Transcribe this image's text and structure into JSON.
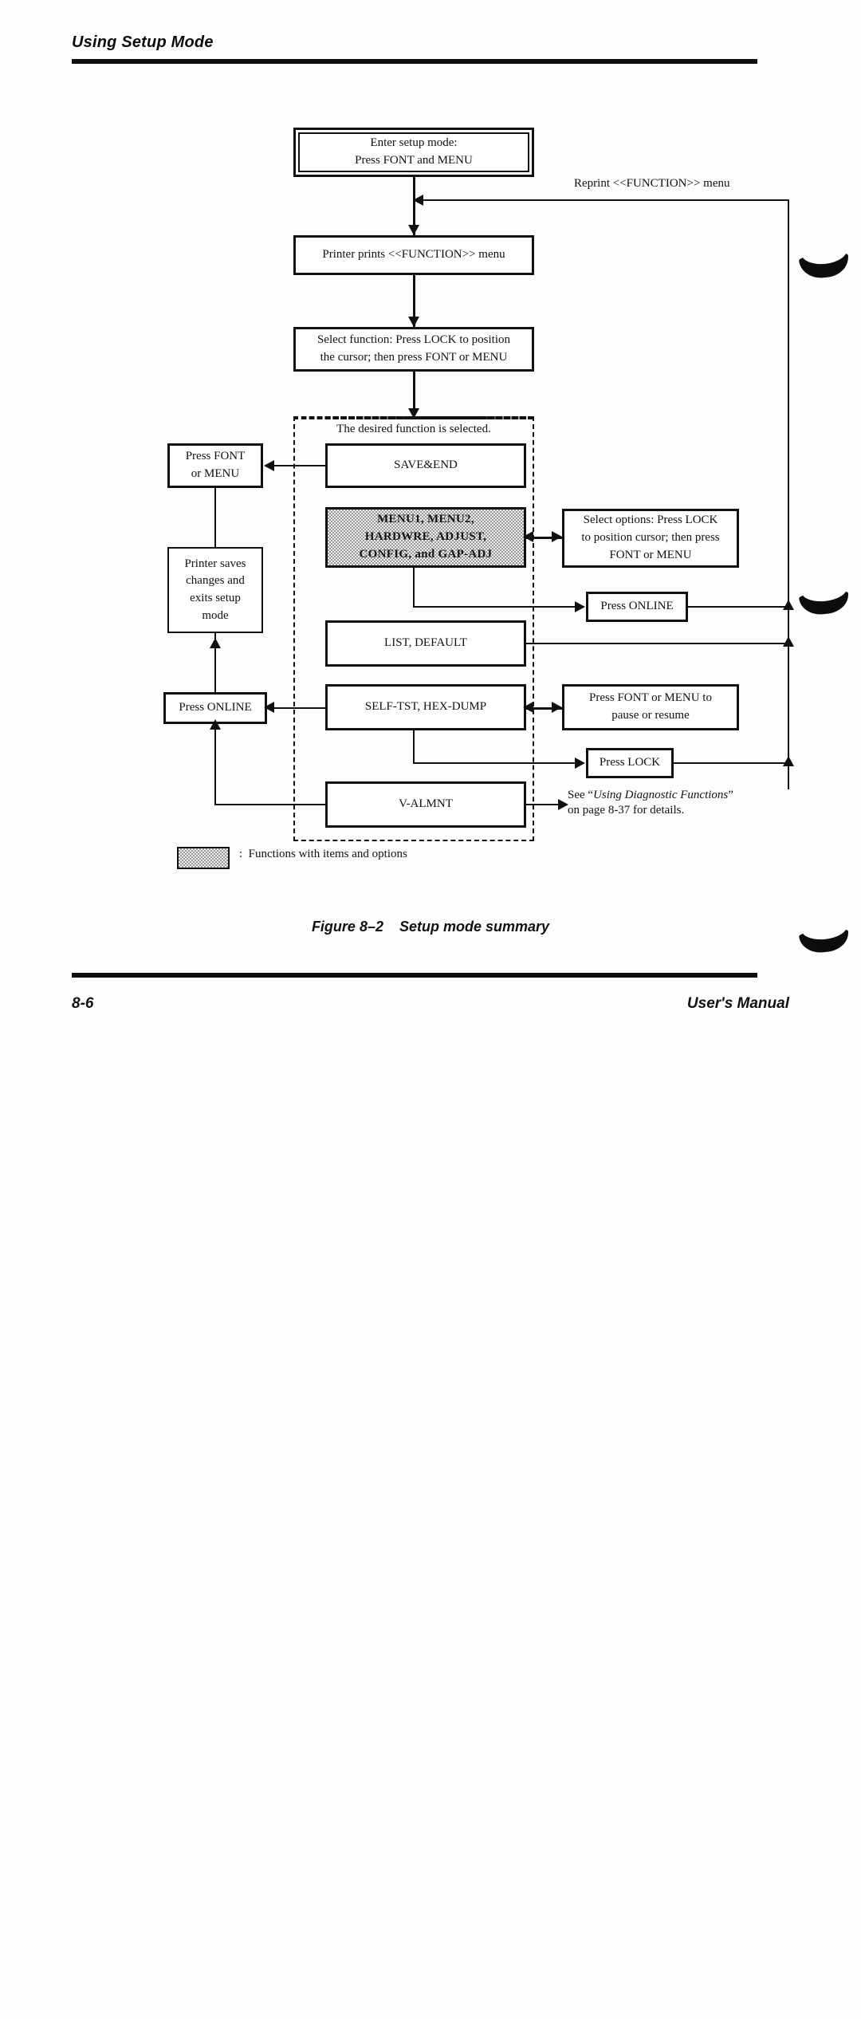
{
  "header": {
    "running_head": "Using Setup Mode"
  },
  "footer": {
    "page_number": "8-6",
    "manual_name": "User's Manual"
  },
  "figure": {
    "caption_number": "Figure 8–2",
    "caption_title": "Setup mode summary",
    "legend_separator": ":",
    "legend_text": "Functions with items and options",
    "group_caption": "The desired function is selected."
  },
  "nodes": {
    "enter_setup": "Enter setup mode:\nPress FONT and MENU",
    "enter_setup_l1": "Enter setup mode:",
    "enter_setup_l2": "Press FONT and MENU",
    "printer_prints": "Printer prints <<FUNCTION>> menu",
    "select_function_l1": "Select function: Press LOCK to position",
    "select_function_l2": "the cursor; then press FONT or MENU",
    "press_font_or_menu_l1": "Press FONT",
    "press_font_or_menu_l2": "or MENU",
    "printer_saves_l1": "Printer saves",
    "printer_saves_l2": "changes and",
    "printer_saves_l3": "exits setup",
    "printer_saves_l4": "mode",
    "press_online_left": "Press ONLINE",
    "save_end": "SAVE&END",
    "menu_group_l1": "MENU1, MENU2,",
    "menu_group_l2": "HARDWRE, ADJUST,",
    "menu_group_l3": "CONFIG, and GAP-ADJ",
    "list_default": "LIST, DEFAULT",
    "self_test": "SELF-TST, HEX-DUMP",
    "v_almnt": "V-ALMNT",
    "select_options_l1": "Select options: Press LOCK",
    "select_options_l2": "to position cursor; then press",
    "select_options_l3": "FONT or MENU",
    "press_online_right": "Press ONLINE",
    "pause_resume_l1": "Press FONT or MENU to",
    "pause_resume_l2": "pause or resume",
    "press_lock": "Press LOCK"
  },
  "edges": {
    "reprint_label": "Reprint <<FUNCTION>> menu"
  },
  "note": {
    "prefix": "See “",
    "italic": "Using Diagnostic Functions",
    "suffix": "”",
    "line2": "on page 8-37 for details."
  },
  "colors": {
    "ink": "#111111",
    "paper": "#fdfdfb",
    "shade": "#9a9a9a"
  }
}
